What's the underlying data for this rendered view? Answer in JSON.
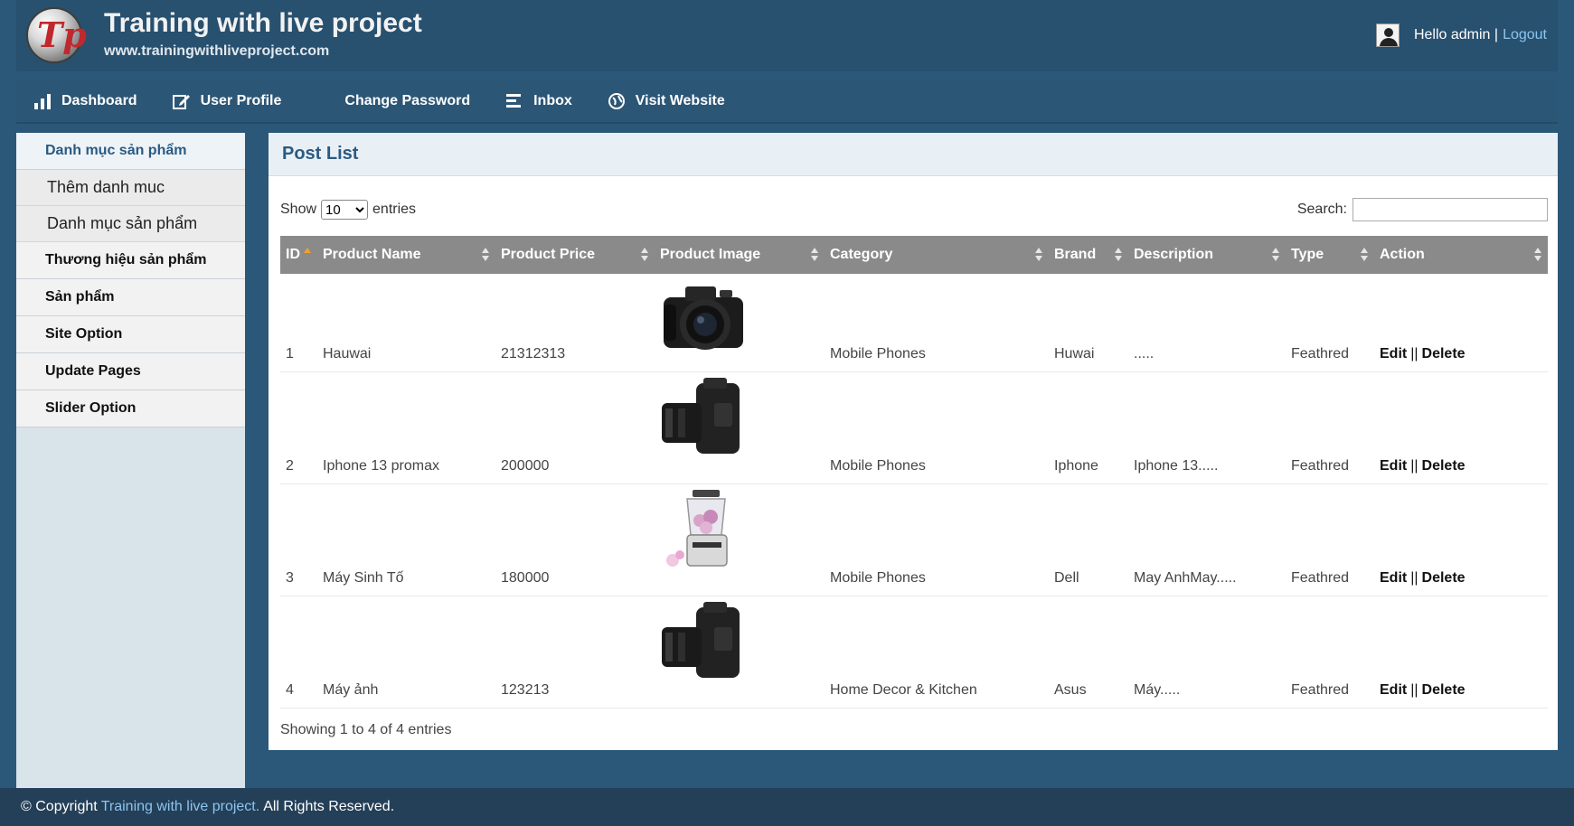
{
  "header": {
    "title": "Training with live project",
    "url": "www.trainingwithliveproject.com",
    "greeting": "Hello admin |",
    "logout_label": "Logout"
  },
  "nav": {
    "items": [
      {
        "label": "Dashboard",
        "icon": "bar-chart-icon"
      },
      {
        "label": "User Profile",
        "icon": "edit-icon"
      },
      {
        "label": "Change Password",
        "icon": ""
      },
      {
        "label": "Inbox",
        "icon": "list-icon"
      },
      {
        "label": "Visit Website",
        "icon": "globe-icon"
      }
    ]
  },
  "sidebar": {
    "items": [
      {
        "label": "Danh mục sản phẩm",
        "active": true
      },
      {
        "label": "Thêm danh muc"
      },
      {
        "label": "Danh mục sản phẩm"
      },
      {
        "label": "Thương hiệu sản phẩm"
      },
      {
        "label": "Sản phẩm"
      },
      {
        "label": "Site Option"
      },
      {
        "label": "Update Pages"
      },
      {
        "label": "Slider Option"
      }
    ]
  },
  "panel": {
    "title": "Post List",
    "show_label": "Show",
    "entries_label": "entries",
    "length_selected": "10",
    "search_label": "Search:",
    "search_value": "",
    "info": "Showing 1 to 4 of 4 entries"
  },
  "table": {
    "columns": [
      "ID",
      "Product Name",
      "Product Price",
      "Product Image",
      "Category",
      "Brand",
      "Description",
      "Type",
      "Action"
    ],
    "rows": [
      {
        "id": "1",
        "name": "Hauwai",
        "price": "21312313",
        "image": "camera-front-image",
        "category": "Mobile Phones",
        "brand": "Huwai",
        "description": ".....",
        "type": "Feathred",
        "edit": "Edit",
        "sep": "||",
        "delete": "Delete"
      },
      {
        "id": "2",
        "name": "Iphone 13 promax",
        "price": "200000",
        "image": "camera-side-image",
        "category": "Mobile Phones",
        "brand": "Iphone",
        "description": "Iphone 13.....",
        "type": "Feathred",
        "edit": "Edit",
        "sep": "||",
        "delete": "Delete"
      },
      {
        "id": "3",
        "name": "Máy Sinh Tố",
        "price": "180000",
        "image": "blender-image",
        "category": "Mobile Phones",
        "brand": "Dell",
        "description": "May AnhMay.....",
        "type": "Feathred",
        "edit": "Edit",
        "sep": "||",
        "delete": "Delete"
      },
      {
        "id": "4",
        "name": "Máy ảnh",
        "price": "123213",
        "image": "camera-side-image",
        "category": "Home Decor & Kitchen",
        "brand": "Asus",
        "description": "Máy.....",
        "type": "Feathred",
        "edit": "Edit",
        "sep": "||",
        "delete": "Delete"
      }
    ]
  },
  "footer": {
    "prefix": "© Copyright",
    "brand": "Training with live project.",
    "suffix": "All Rights Reserved."
  },
  "colors": {
    "background": "#2b5878",
    "header": "#28506f",
    "table_header": "#8a8a8a",
    "link": "#8cc5ef",
    "panel_title": "#2a5a82"
  }
}
